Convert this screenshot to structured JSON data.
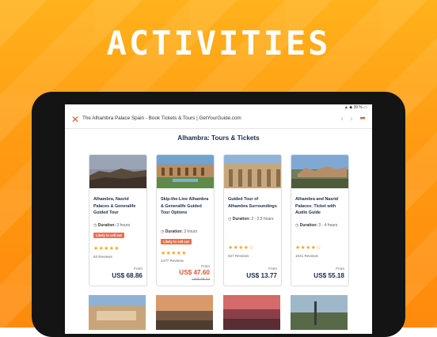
{
  "headline": "ACTIVITIES",
  "status": {
    "battery": "39 %"
  },
  "browser": {
    "url_title": "The Alhambra Palace Spain - Book Tickets & Tours | GetYourGuide.com",
    "close_icon": "close-icon",
    "back_icon": "chevron-left-icon",
    "forward_icon": "chevron-right-icon",
    "share_icon": "share-icon"
  },
  "page": {
    "title": "Alhambra: Tours & Tickets"
  },
  "cards": [
    {
      "title": "Alhambra, Nasrid Palaces & Generalife Guided Tour",
      "duration_label": "Duration:",
      "duration": "3 hours",
      "badge": "Likely to sell out",
      "stars": "★★★★★",
      "reviews": "63 Reviews",
      "from": "From",
      "price": "US$ 68.86",
      "old_price": ""
    },
    {
      "title": "Skip-the-Line Alhambra & Generalife Guided Tour Options",
      "duration_label": "Duration:",
      "duration": "3 hours",
      "badge": "Likely to sell out",
      "stars": "★★★★★",
      "reviews": "1477 Reviews",
      "from": "From",
      "price": "US$ 47.60",
      "old_price": "US$ 79.33"
    },
    {
      "title": "Guided Tour of Alhambra Surroundings",
      "duration_label": "Duration:",
      "duration": "2 - 2.5 hours",
      "badge": "",
      "stars": "★★★★☆",
      "reviews": "627 Reviews",
      "from": "From",
      "price": "US$ 13.77",
      "old_price": ""
    },
    {
      "title": "Alhambra and Nasrid Palaces: Ticket with Audio Guide",
      "duration_label": "Duration:",
      "duration": "3 - 4 hours",
      "badge": "",
      "stars": "★★★★☆",
      "reviews": "1041 Reviews",
      "from": "From",
      "price": "US$ 55.18",
      "old_price": ""
    }
  ],
  "colors": {
    "accent": "#e4542d",
    "navy": "#1a2b49",
    "star": "#f5a623",
    "background": "#ff9a12"
  }
}
